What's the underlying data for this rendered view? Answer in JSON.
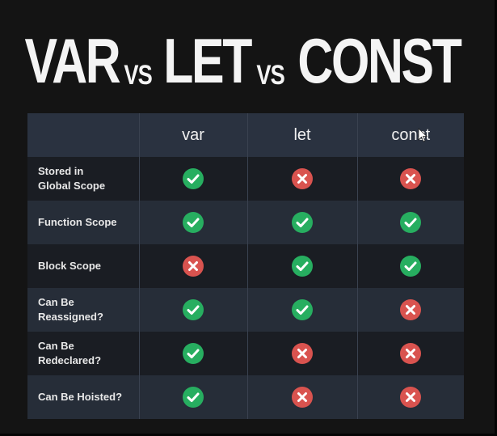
{
  "title": {
    "word1": "VAR",
    "sep1": "VS",
    "word2": "LET",
    "sep2": "VS",
    "word3": "CONST"
  },
  "table": {
    "columns": [
      "",
      "var",
      "let",
      "const"
    ],
    "rows": [
      {
        "label_line1": "Stored in",
        "label_line2": "Global Scope",
        "values": [
          "yes",
          "no",
          "no"
        ]
      },
      {
        "label_line1": "Function Scope",
        "label_line2": "",
        "values": [
          "yes",
          "yes",
          "yes"
        ]
      },
      {
        "label_line1": "Block Scope",
        "label_line2": "",
        "values": [
          "no",
          "yes",
          "yes"
        ]
      },
      {
        "label_line1": "Can Be",
        "label_line2": "Reassigned?",
        "values": [
          "yes",
          "yes",
          "no"
        ]
      },
      {
        "label_line1": "Can Be",
        "label_line2": "Redeclared?",
        "values": [
          "yes",
          "no",
          "no"
        ]
      },
      {
        "label_line1": "Can Be Hoisted?",
        "label_line2": "",
        "values": [
          "yes",
          "no",
          "no"
        ]
      }
    ]
  },
  "icons": {
    "yes": "check-circle-icon",
    "no": "x-circle-icon",
    "pointer": "mouse-pointer-icon"
  },
  "colors": {
    "yes": "#27ae60",
    "no": "#d9534f",
    "header_bg": "#2a3240",
    "row_odd_bg": "#1a1d23",
    "row_even_bg": "#262d38",
    "background": "#141414"
  }
}
